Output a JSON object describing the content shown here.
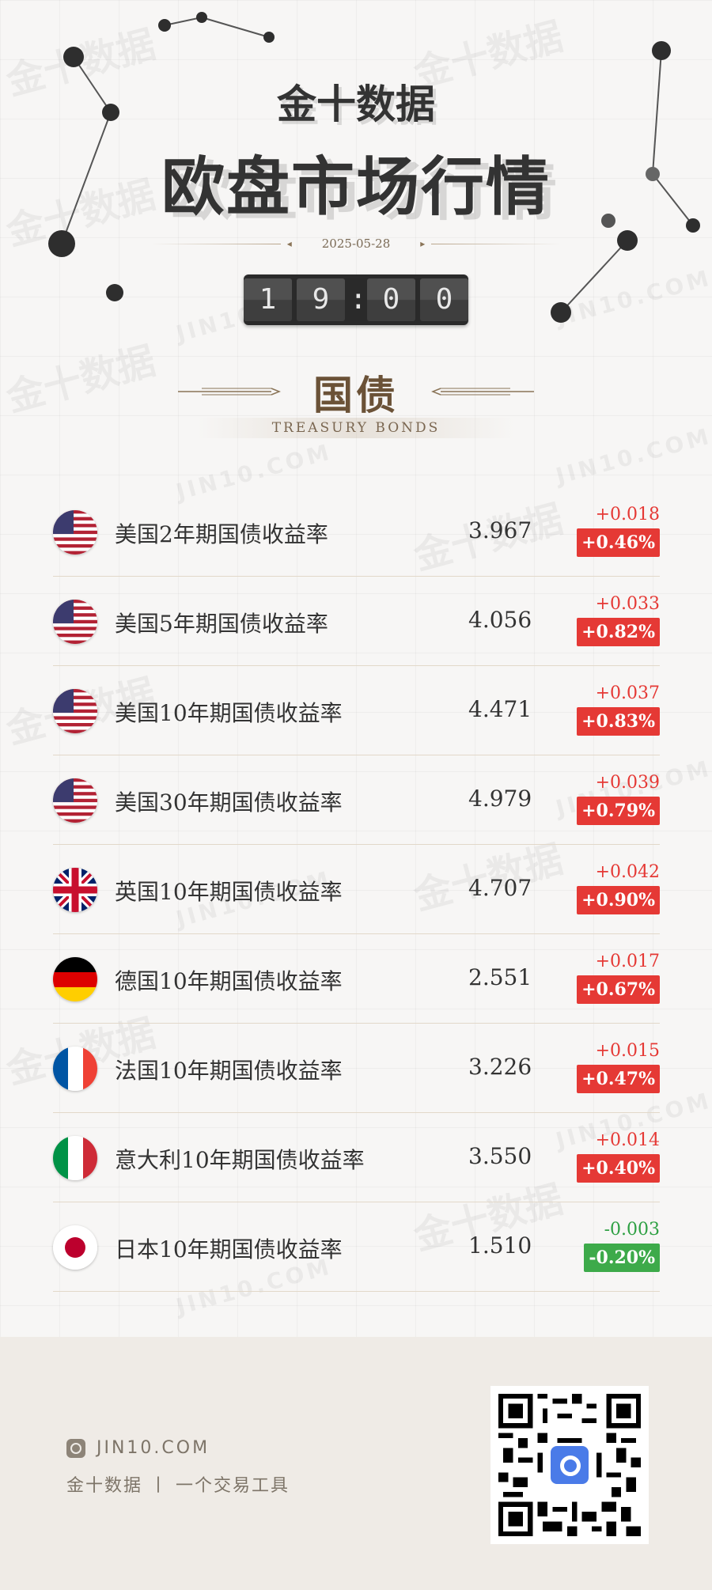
{
  "header": {
    "brand": "金十数据",
    "title": "欧盘市场行情",
    "date": "2025-05-28",
    "time_digits": [
      "1",
      "9",
      ":",
      "0",
      "0"
    ]
  },
  "section": {
    "title": "国债",
    "subtitle": "TREASURY BONDS"
  },
  "bonds": [
    {
      "name": "美国2年期国债收益率",
      "value": "3.967",
      "change": "+0.018",
      "pct": "+0.46%",
      "dir": "up",
      "flag": "us-flag-icon"
    },
    {
      "name": "美国5年期国债收益率",
      "value": "4.056",
      "change": "+0.033",
      "pct": "+0.82%",
      "dir": "up",
      "flag": "us-flag-icon"
    },
    {
      "name": "美国10年期国债收益率",
      "value": "4.471",
      "change": "+0.037",
      "pct": "+0.83%",
      "dir": "up",
      "flag": "us-flag-icon"
    },
    {
      "name": "美国30年期国债收益率",
      "value": "4.979",
      "change": "+0.039",
      "pct": "+0.79%",
      "dir": "up",
      "flag": "us-flag-icon"
    },
    {
      "name": "英国10年期国债收益率",
      "value": "4.707",
      "change": "+0.042",
      "pct": "+0.90%",
      "dir": "up",
      "flag": "uk-flag-icon"
    },
    {
      "name": "德国10年期国债收益率",
      "value": "2.551",
      "change": "+0.017",
      "pct": "+0.67%",
      "dir": "up",
      "flag": "germany-flag-icon"
    },
    {
      "name": "法国10年期国债收益率",
      "value": "3.226",
      "change": "+0.015",
      "pct": "+0.47%",
      "dir": "up",
      "flag": "france-flag-icon"
    },
    {
      "name": "意大利10年期国债收益率",
      "value": "3.550",
      "change": "+0.014",
      "pct": "+0.40%",
      "dir": "up",
      "flag": "italy-flag-icon"
    },
    {
      "name": "日本10年期国债收益率",
      "value": "1.510",
      "change": "-0.003",
      "pct": "-0.20%",
      "dir": "down",
      "flag": "japan-flag-icon"
    }
  ],
  "footer": {
    "site": "JIN10.COM",
    "slogan": "金十数据 丨 一个交易工具",
    "qr_icon": "qr-code-icon"
  },
  "watermarks": {
    "cn": "金十数据",
    "en": "JIN10.COM"
  },
  "colors": {
    "up": "#e53935",
    "down": "#3daa4a",
    "accent": "#6b5237"
  }
}
